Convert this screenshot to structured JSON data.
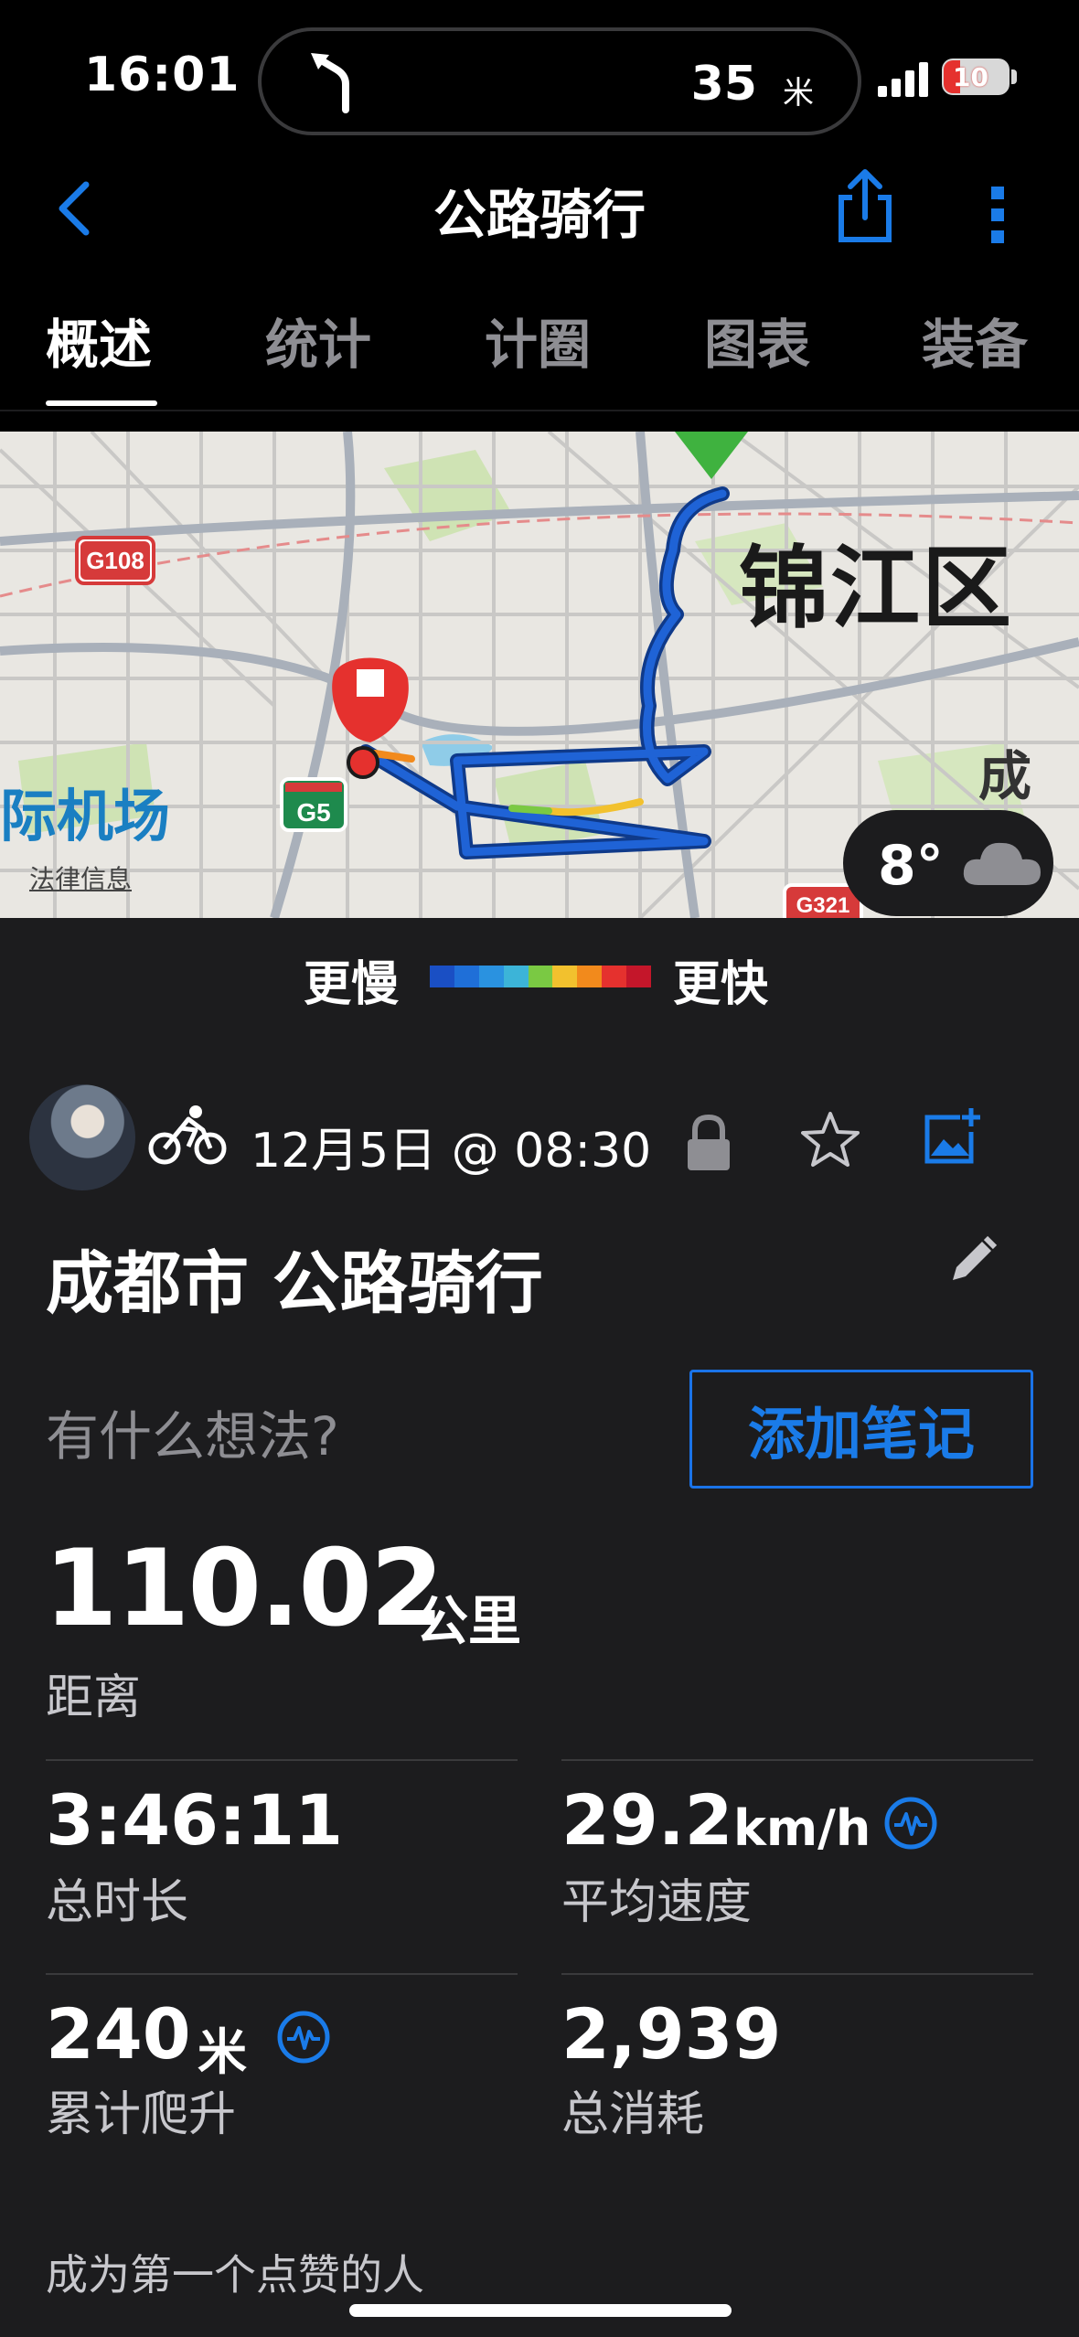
{
  "status_bar": {
    "time": "16:01",
    "nav_distance": "35",
    "nav_unit": "米",
    "battery": "10"
  },
  "nav": {
    "title": "公路骑行",
    "back_icon": "chevron-left-icon",
    "share_icon": "share-icon",
    "more_icon": "more-vertical-icon"
  },
  "tabs": [
    {
      "label": "概述",
      "active": true
    },
    {
      "label": "统计",
      "active": false
    },
    {
      "label": "计圈",
      "active": false
    },
    {
      "label": "图表",
      "active": false
    },
    {
      "label": "装备",
      "active": false
    }
  ],
  "map": {
    "district_label": "锦江区",
    "city_label": "成都",
    "airport_label": "际机场",
    "road_g108": "G108",
    "road_g5": "G5",
    "road_g321": "G321",
    "legal_link": "法律信息",
    "weather_temp": "8°",
    "weather_icon": "cloud-icon"
  },
  "speed_legend": {
    "slow_label": "更慢",
    "fast_label": "更快",
    "colors": [
      "#1a4fc4",
      "#1f6fd8",
      "#2a92e0",
      "#3cb4d8",
      "#7ac943",
      "#f2c12e",
      "#f28a1c",
      "#e5312e",
      "#c4162a"
    ]
  },
  "activity": {
    "date": "12月5日 @ 08:30",
    "title": "成都市 公路骑行",
    "thought_prompt": "有什么想法?",
    "add_note_label": "添加笔记",
    "distance_value": "110.02",
    "distance_unit": "公里",
    "distance_label": "距离",
    "stats": [
      {
        "value": "3:46:11",
        "unit": "",
        "label": "总时长",
        "pulse": false
      },
      {
        "value": "29.2",
        "unit": "km/h",
        "label": "平均速度",
        "pulse": true
      },
      {
        "value": "240",
        "unit": "米",
        "label": "累计爬升",
        "pulse": true
      },
      {
        "value": "2,939",
        "unit": "",
        "label": "总消耗",
        "pulse": false
      }
    ],
    "likes_text": "成为第一个点赞的人"
  },
  "colors": {
    "accent": "#1a73e8",
    "background": "#1c1c1e",
    "start_marker": "#3fb23f",
    "end_marker": "#e5312e"
  }
}
